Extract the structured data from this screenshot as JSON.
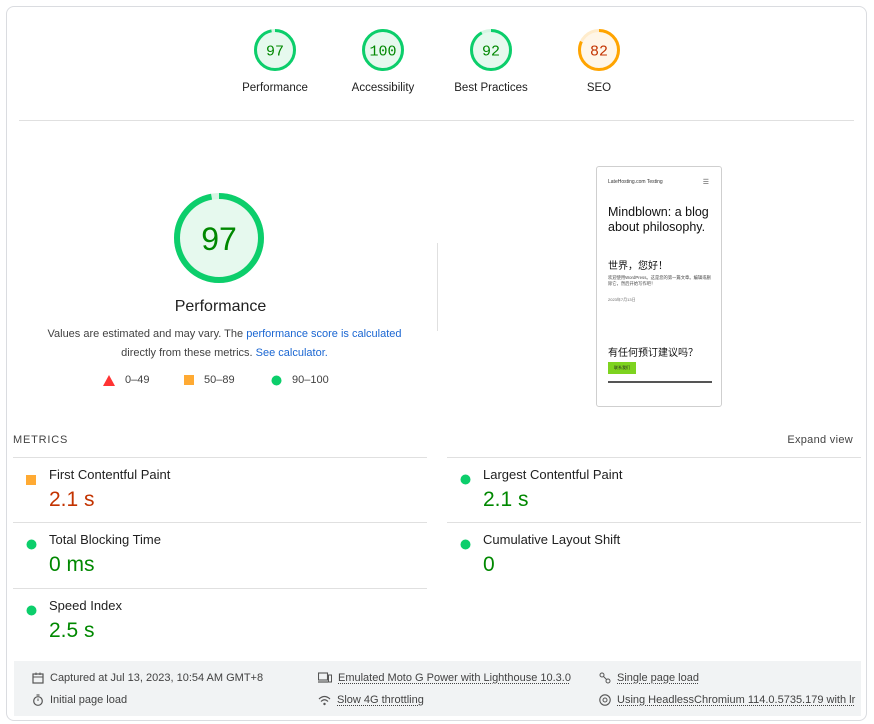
{
  "gauges": [
    {
      "score": "97",
      "label": "Performance",
      "rating": "pass",
      "fraction": 0.97
    },
    {
      "score": "100",
      "label": "Accessibility",
      "rating": "pass",
      "fraction": 1.0
    },
    {
      "score": "92",
      "label": "Best Practices",
      "rating": "pass",
      "fraction": 0.92
    },
    {
      "score": "82",
      "label": "SEO",
      "rating": "average",
      "fraction": 0.82
    }
  ],
  "colors": {
    "pass": "#0cce6b",
    "pass_text": "#008800",
    "average": "#ffa400",
    "average_text": "#c33300",
    "fail": "#ff4e42"
  },
  "performance": {
    "score": "97",
    "fraction": 0.97,
    "title": "Performance",
    "desc_prefix": "Values are estimated and may vary. The ",
    "desc_link1": "performance score is calculated",
    "desc_middle": "directly from these metrics. ",
    "desc_link2": "See calculator."
  },
  "legend": [
    {
      "shape": "triangle",
      "range": "0–49"
    },
    {
      "shape": "square",
      "range": "50–89"
    },
    {
      "shape": "circle",
      "range": "90–100"
    }
  ],
  "screenshot": {
    "site_name": "LateHosting.com Testing",
    "menu_icon": "hamburger-icon",
    "heading": "Mindblown: a blog about philosophy.",
    "greeting": "世界，您好！",
    "excerpt": "欢迎使用WordPress。这是您的第一篇文章。编辑或删除它，然后开始写作吧！",
    "date": "2023年7月13日",
    "question": "有任何预订建议吗？",
    "button": "联系我们"
  },
  "metrics": {
    "header": "METRICS",
    "expand": "Expand view",
    "items": [
      {
        "name": "First Contentful Paint",
        "value": "2.1 s",
        "rating": "average"
      },
      {
        "name": "Largest Contentful Paint",
        "value": "2.1 s",
        "rating": "pass"
      },
      {
        "name": "Total Blocking Time",
        "value": "0 ms",
        "rating": "pass"
      },
      {
        "name": "Cumulative Layout Shift",
        "value": "0",
        "rating": "pass"
      },
      {
        "name": "Speed Index",
        "value": "2.5 s",
        "rating": "pass"
      }
    ]
  },
  "footer": {
    "captured": "Captured at Jul 13, 2023, 10:54 AM GMT+8",
    "emulated": "Emulated Moto G Power with Lighthouse 10.3.0",
    "single": "Single page load",
    "initial": "Initial page load",
    "throttling": "Slow 4G throttling",
    "browser": "Using HeadlessChromium 114.0.5735.179 with lr"
  }
}
